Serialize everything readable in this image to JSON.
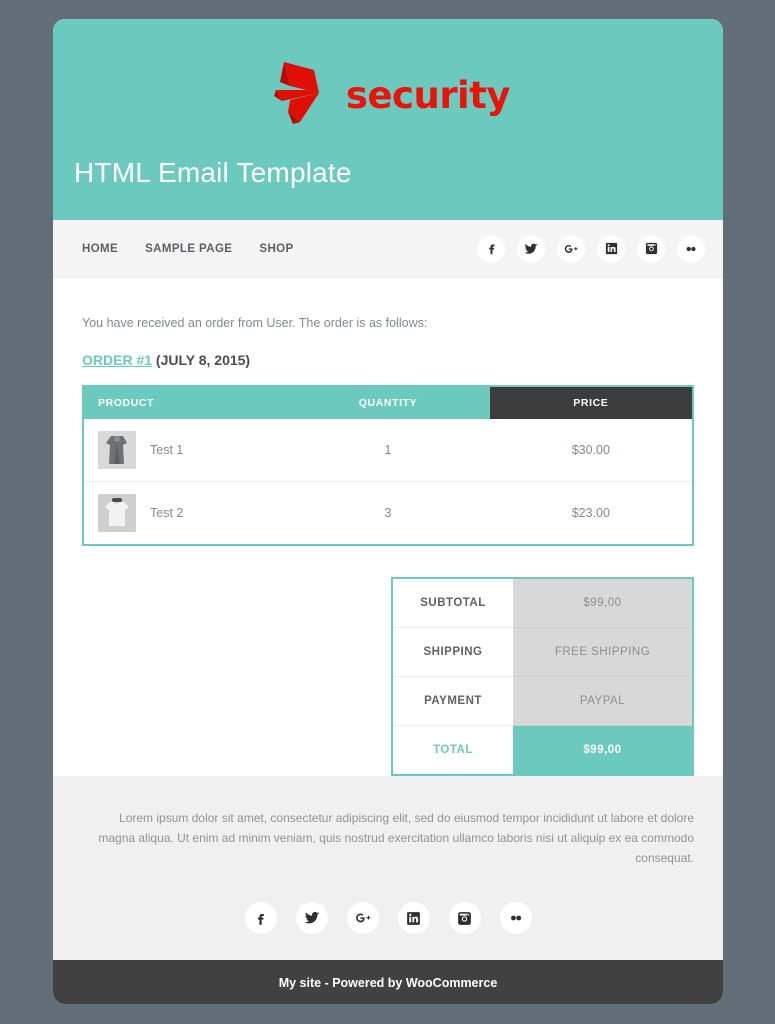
{
  "theme": {
    "accent": "#6bc9bd",
    "dark": "#3c3c3c",
    "page_background": "#646e78",
    "logo_red": "#e8140c",
    "nav_background": "#f4f4f4",
    "footer_background": "#f0f0f0",
    "bottombar_background": "#414141"
  },
  "header": {
    "logo_text": "security",
    "title": "HTML Email Template"
  },
  "nav": {
    "links": [
      {
        "label": "HOME"
      },
      {
        "label": "SAMPLE PAGE"
      },
      {
        "label": "SHOP"
      }
    ],
    "social": [
      {
        "name": "facebook-icon"
      },
      {
        "name": "twitter-icon"
      },
      {
        "name": "google-plus-icon"
      },
      {
        "name": "linkedin-icon"
      },
      {
        "name": "instagram-icon"
      },
      {
        "name": "flickr-icon"
      }
    ]
  },
  "main": {
    "intro": "You have received an order from User. The order is as follows:",
    "order_link": "ORDER #1",
    "order_date": " (JULY 8, 2015)",
    "table": {
      "columns": {
        "product": "PRODUCT",
        "quantity": "QUANTITY",
        "price": "PRICE"
      },
      "rows": [
        {
          "product": "Test 1",
          "quantity": "1",
          "price": "$30.00"
        },
        {
          "product": "Test 2",
          "quantity": "3",
          "price": "$23.00"
        }
      ]
    },
    "totals": [
      {
        "label": "SUBTOTAL",
        "value": "$99,00"
      },
      {
        "label": "SHIPPING",
        "value": "FREE SHIPPING"
      },
      {
        "label": "PAYMENT",
        "value": "PAYPAL"
      },
      {
        "label": "TOTAL",
        "value": "$99,00"
      }
    ]
  },
  "footer": {
    "text": "Lorem ipsum dolor sit amet, consectetur adipiscing elit, sed do eiusmod tempor incididunt ut labore et dolore magna aliqua. Ut enim ad minim veniam, quis nostrud exercitation ullamco laboris nisi ut aliquip ex ea commodo consequat.",
    "social": [
      {
        "name": "facebook-icon"
      },
      {
        "name": "twitter-icon"
      },
      {
        "name": "google-plus-icon"
      },
      {
        "name": "linkedin-icon"
      },
      {
        "name": "instagram-icon"
      },
      {
        "name": "flickr-icon"
      }
    ],
    "bottombar": "My site - Powered by WooCommerce"
  }
}
